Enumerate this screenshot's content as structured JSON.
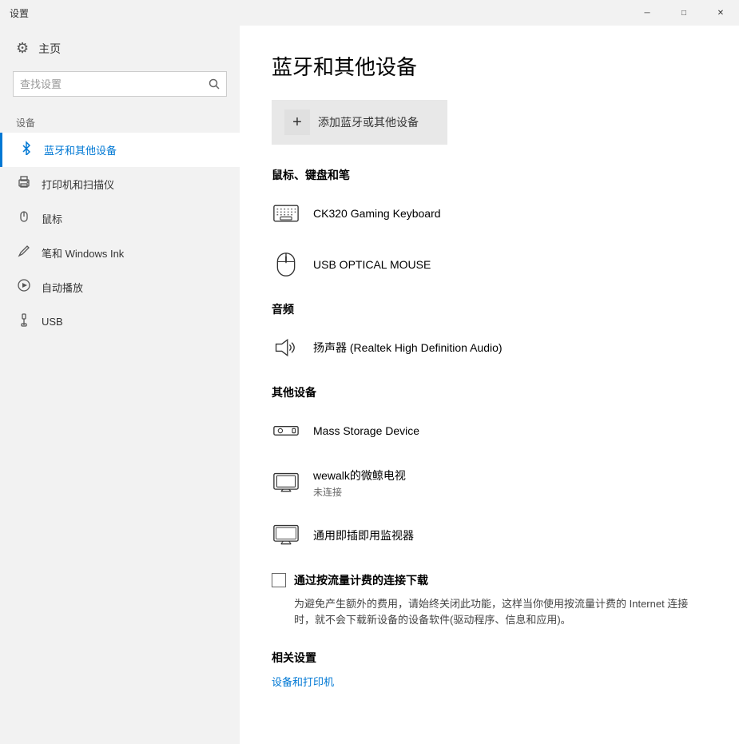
{
  "window": {
    "title": "设置",
    "controls": {
      "minimize": "─",
      "maximize": "□",
      "close": "✕"
    }
  },
  "sidebar": {
    "home_label": "主页",
    "search_placeholder": "查找设置",
    "section_label": "设备",
    "items": [
      {
        "id": "bluetooth",
        "label": "蓝牙和其他设备",
        "active": true
      },
      {
        "id": "printers",
        "label": "打印机和扫描仪",
        "active": false
      },
      {
        "id": "mouse",
        "label": "鼠标",
        "active": false
      },
      {
        "id": "pen",
        "label": "笔和 Windows Ink",
        "active": false
      },
      {
        "id": "autoplay",
        "label": "自动播放",
        "active": false
      },
      {
        "id": "usb",
        "label": "USB",
        "active": false
      }
    ]
  },
  "main": {
    "title": "蓝牙和其他设备",
    "add_device_label": "添加蓝牙或其他设备",
    "sections": {
      "mouse_keyboard_pen": {
        "title": "鼠标、键盘和笔",
        "devices": [
          {
            "id": "keyboard",
            "name": "CK320 Gaming Keyboard",
            "sub": ""
          },
          {
            "id": "mouse",
            "name": "USB OPTICAL MOUSE",
            "sub": ""
          }
        ]
      },
      "audio": {
        "title": "音频",
        "devices": [
          {
            "id": "speaker",
            "name": "扬声器 (Realtek High Definition Audio)",
            "sub": ""
          }
        ]
      },
      "other": {
        "title": "其他设备",
        "devices": [
          {
            "id": "storage",
            "name": "Mass Storage Device",
            "sub": ""
          },
          {
            "id": "tv",
            "name": "wewalk的微鲸电视",
            "sub": "未连接"
          },
          {
            "id": "monitor",
            "name": "通用即插即用监视器",
            "sub": ""
          }
        ]
      }
    },
    "metered": {
      "checkbox_label": "通过按流量计费的连接下载",
      "description": "为避免产生额外的费用，请始终关闭此功能，这样当你使用按流量计费的 Internet 连接时，就不会下载新设备的设备软件(驱动程序、信息和应用)。"
    },
    "related": {
      "title": "相关设置",
      "links": [
        {
          "label": "设备和打印机",
          "href": "#"
        }
      ]
    }
  }
}
